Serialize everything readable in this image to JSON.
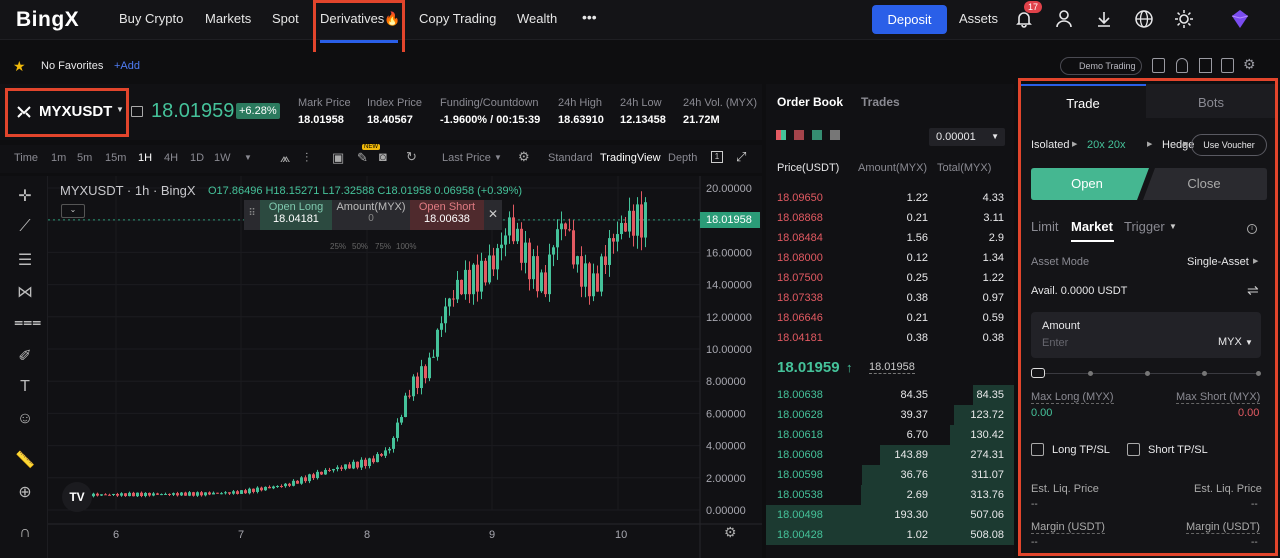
{
  "nav": {
    "logo": "BingX",
    "items": [
      "Buy Crypto",
      "Markets",
      "Spot",
      "Derivatives🔥",
      "Copy Trading",
      "Wealth"
    ],
    "more": "•••",
    "deposit": "Deposit",
    "assets": "Assets",
    "notif_count": "17"
  },
  "fav": {
    "label": "No Favorites",
    "add": "+Add",
    "demo": "Demo Trading"
  },
  "symbol": {
    "name": "MYXUSDT",
    "price": "18.01959",
    "change": "+6.28%",
    "stats": [
      {
        "label": "Mark Price",
        "value": "18.01958"
      },
      {
        "label": "Index Price",
        "value": "18.40567"
      },
      {
        "label": "Funding/Countdown",
        "value": "-1.9600% / 00:15:39"
      },
      {
        "label": "24h High",
        "value": "18.63910"
      },
      {
        "label": "24h Low",
        "value": "12.13458"
      },
      {
        "label": "24h Vol. (MYX)",
        "value": "21.72M"
      }
    ]
  },
  "timeframe": {
    "items": [
      "Time",
      "1m",
      "5m",
      "15m",
      "1H",
      "4H",
      "1D",
      "1W"
    ],
    "active": "1H",
    "last_price": "Last Price",
    "standard": "Standard",
    "tradingview": "TradingView",
    "depth": "Depth",
    "new_badge": "NEW"
  },
  "chart": {
    "legend": "MYXUSDT · 1h · BingX",
    "ohlc": "O17.86496  H18.15271  L17.32588  C18.01958  0.06958 (+0.39%)",
    "open_long_label": "Open Long",
    "open_long_value": "18.04181",
    "amount_label": "Amount(MYX)",
    "amount_value": "0",
    "open_short_label": "Open Short",
    "open_short_value": "18.00638",
    "pcts": [
      "25%",
      "50%",
      "75%",
      "100%"
    ],
    "price_tag": "18.01958",
    "y_ticks": [
      "20.00000",
      "18.00000",
      "16.00000",
      "14.00000",
      "12.00000",
      "10.00000",
      "8.00000",
      "6.00000",
      "4.00000",
      "2.00000",
      "0.00000"
    ],
    "x_ticks": [
      "6",
      "7",
      "8",
      "9",
      "10"
    ],
    "tv_logo": "TV"
  },
  "orderbook": {
    "tabs": [
      "Order Book",
      "Trades"
    ],
    "precision": "0.00001",
    "headers": [
      "Price(USDT)",
      "Amount(MYX)",
      "Total(MYX)"
    ],
    "asks": [
      [
        "18.09650",
        "1.22",
        "4.33"
      ],
      [
        "18.08868",
        "0.21",
        "3.11"
      ],
      [
        "18.08484",
        "1.56",
        "2.9"
      ],
      [
        "18.08000",
        "0.12",
        "1.34"
      ],
      [
        "18.07500",
        "0.25",
        "1.22"
      ],
      [
        "18.07338",
        "0.38",
        "0.97"
      ],
      [
        "18.06646",
        "0.21",
        "0.59"
      ],
      [
        "18.04181",
        "0.38",
        "0.38"
      ]
    ],
    "mid_price": "18.01959",
    "mark": "18.01958",
    "bids": [
      [
        "18.00638",
        "84.35",
        "84.35"
      ],
      [
        "18.00628",
        "39.37",
        "123.72"
      ],
      [
        "18.00618",
        "6.70",
        "130.42"
      ],
      [
        "18.00608",
        "143.89",
        "274.31"
      ],
      [
        "18.00598",
        "36.76",
        "311.07"
      ],
      [
        "18.00538",
        "2.69",
        "313.76"
      ],
      [
        "18.00498",
        "193.30",
        "507.06"
      ],
      [
        "18.00428",
        "1.02",
        "508.08"
      ]
    ]
  },
  "trade": {
    "tabs": [
      "Trade",
      "Bots"
    ],
    "isolated": "Isolated",
    "leverage": "20x 20x",
    "hedge": "Hedge",
    "voucher": "Use Voucher",
    "open": "Open",
    "close": "Close",
    "order_types": [
      "Limit",
      "Market",
      "Trigger"
    ],
    "asset_mode_label": "Asset Mode",
    "asset_mode_value": "Single-Asset",
    "avail": "Avail. 0.0000 USDT",
    "amount_label": "Amount",
    "amount_placeholder": "Enter",
    "amount_unit": "MYX",
    "max_long_label": "Max Long (MYX)",
    "max_long_value": "0.00",
    "max_short_label": "Max Short (MYX)",
    "max_short_value": "0.00",
    "long_tpsl": "Long TP/SL",
    "short_tpsl": "Short TP/SL",
    "est_liq": "Est. Liq. Price",
    "dash": "--",
    "margin": "Margin (USDT)"
  },
  "colors": {
    "up": "#45c29a",
    "down": "#e35a62",
    "accent": "#2a5fe8",
    "highlight": "#e2452c"
  }
}
